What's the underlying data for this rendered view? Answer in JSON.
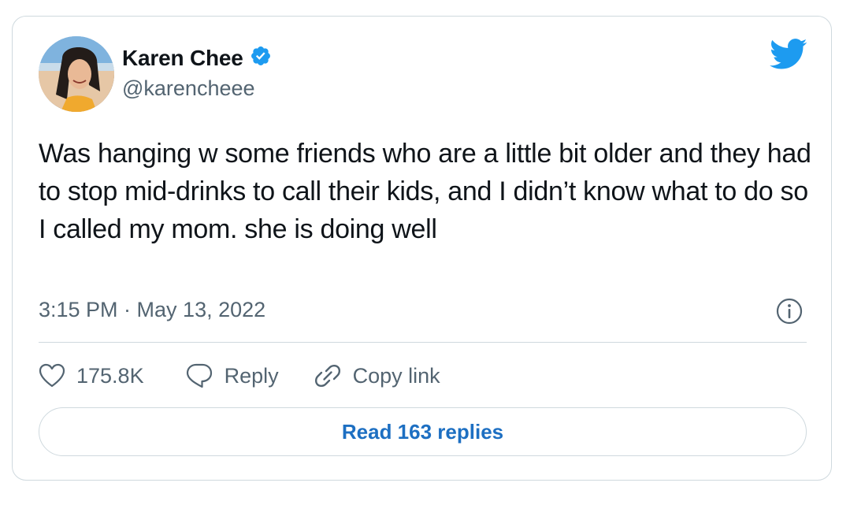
{
  "author": {
    "display_name": "Karen Chee",
    "handle": "@karencheee",
    "verified": true
  },
  "tweet": {
    "text": "Was hanging w some friends who are a little bit older and they had to stop mid-drinks to call their kids, and I didn’t know what to do so I called my mom. she is doing well",
    "timestamp": "3:15 PM · May 13, 2022"
  },
  "actions": {
    "like_count": "175.8K",
    "reply_label": "Reply",
    "copy_link_label": "Copy link"
  },
  "read_replies_label": "Read 163 replies",
  "icons": {
    "logo": "twitter-bird-icon",
    "verified": "verified-badge-icon",
    "info": "info-icon",
    "like": "heart-icon",
    "reply": "reply-bubble-icon",
    "copy_link": "link-icon"
  },
  "colors": {
    "twitter_blue": "#1d9bf0",
    "link_blue": "#1d6fc2",
    "text_primary": "#0f1419",
    "text_secondary": "#536471",
    "border": "#cfd9de"
  }
}
